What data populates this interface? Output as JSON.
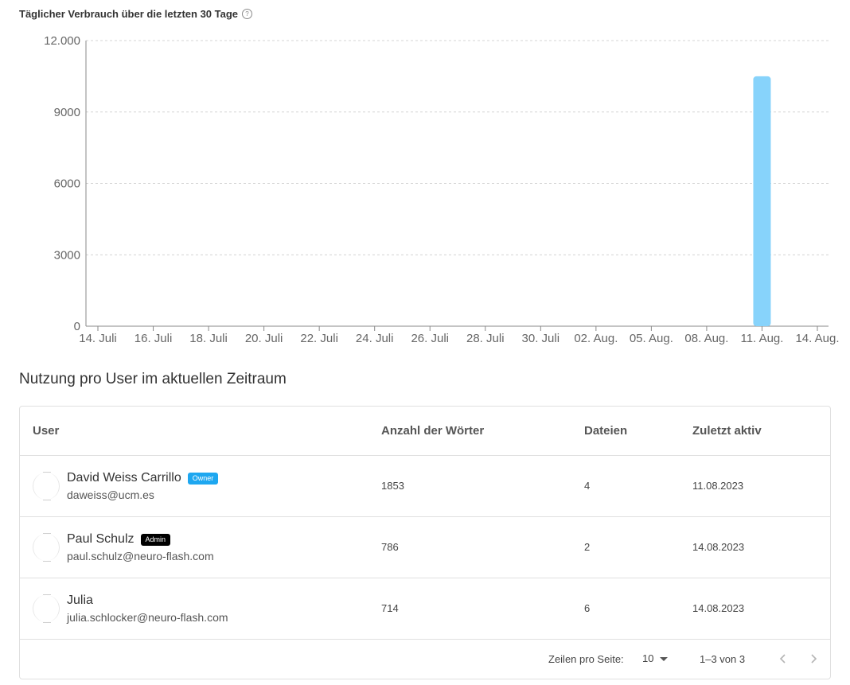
{
  "chart_section": {
    "title": "Täglicher Verbrauch über die letzten 30 Tage",
    "help_icon": "help-circle-icon"
  },
  "chart_data": {
    "type": "bar",
    "title": "Täglicher Verbrauch über die letzten 30 Tage",
    "xlabel": "",
    "ylabel": "",
    "ylim": [
      0,
      12000
    ],
    "yticks": [
      0,
      3000,
      6000,
      9000,
      12000
    ],
    "ytick_labels": [
      "0",
      "3000",
      "6000",
      "9000",
      "12.000"
    ],
    "xtick_labels": [
      "14. Juli",
      "16. Juli",
      "18. Juli",
      "20. Juli",
      "22. Juli",
      "24. Juli",
      "26. Juli",
      "28. Juli",
      "30. Juli",
      "02. Aug.",
      "05. Aug.",
      "08. Aug.",
      "11. Aug.",
      "14. Aug."
    ],
    "bars": [
      {
        "date": "11. Aug.",
        "value": 10500
      }
    ],
    "bar_color": "#87d3fb",
    "grid": true
  },
  "table_section": {
    "title": "Nutzung pro User im aktuellen Zeitraum",
    "headers": {
      "user": "User",
      "words": "Anzahl der Wörter",
      "files": "Dateien",
      "last_active": "Zuletzt aktiv"
    },
    "rows": [
      {
        "name": "David Weiss Carrillo",
        "badge": "Owner",
        "email": "daweiss@ucm.es",
        "words": "1853",
        "files": "4",
        "last_active": "11.08.2023"
      },
      {
        "name": "Paul Schulz",
        "badge": "Admin",
        "email": "paul.schulz@neuro-flash.com",
        "words": "786",
        "files": "2",
        "last_active": "14.08.2023"
      },
      {
        "name": "Julia",
        "badge": "",
        "email": "julia.schlocker@neuro-flash.com",
        "words": "714",
        "files": "6",
        "last_active": "14.08.2023"
      }
    ],
    "footer": {
      "rows_per_page_label": "Zeilen pro Seite:",
      "rows_per_page_value": "10",
      "range_label": "1–3 von 3",
      "prev_icon": "chevron-left-icon",
      "next_icon": "chevron-right-icon"
    }
  },
  "colors": {
    "owner_badge": "#1ea7f0",
    "admin_badge": "#000000",
    "bar": "#87d3fb"
  }
}
